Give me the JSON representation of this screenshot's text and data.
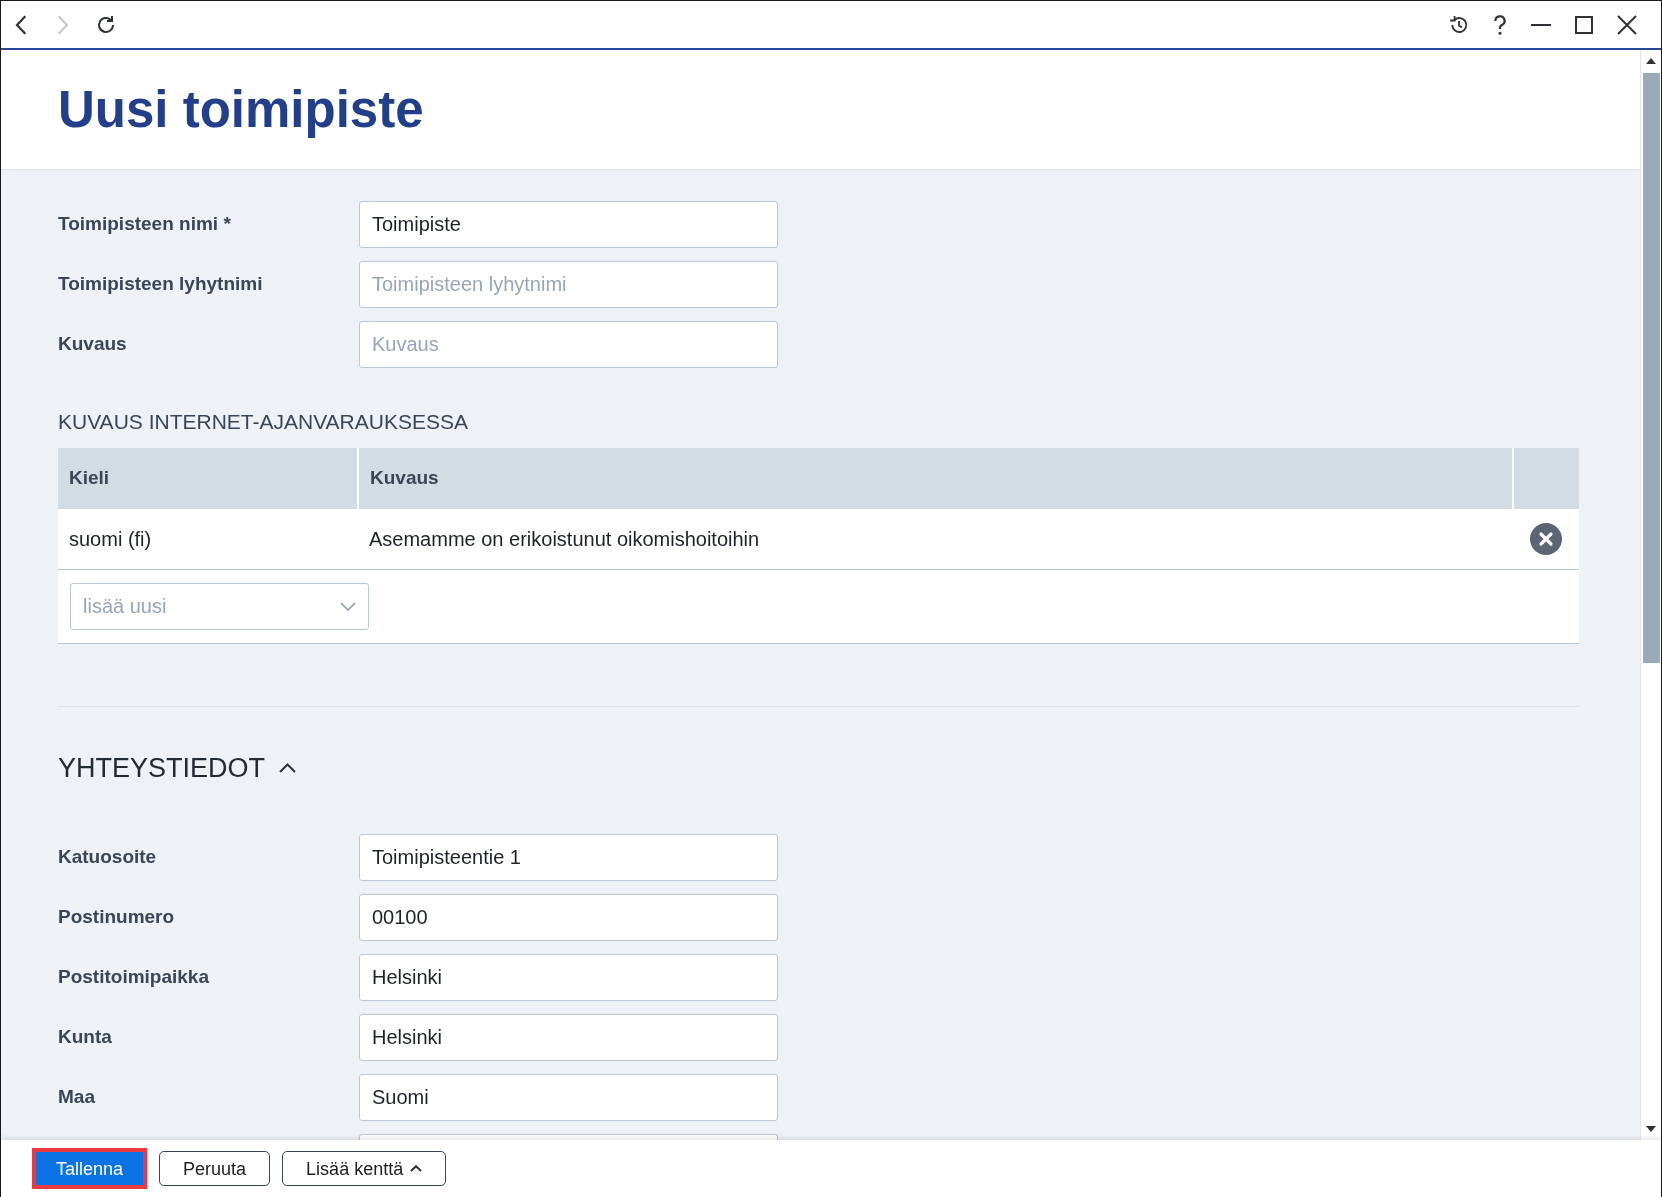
{
  "title_bar": {
    "navigation": [
      {
        "kind": "back",
        "disabled": false
      },
      {
        "kind": "forward",
        "disabled": true
      },
      {
        "kind": "reload",
        "disabled": false
      }
    ],
    "window_controls": [
      {
        "kind": "history"
      },
      {
        "kind": "help"
      },
      {
        "kind": "minimize"
      },
      {
        "kind": "maximize"
      },
      {
        "kind": "close"
      }
    ]
  },
  "page_title": "Uusi toimipiste",
  "basic_fields": [
    {
      "label": "Toimipisteen nimi *",
      "value": "Toimipiste"
    },
    {
      "label": "Toimipisteen lyhytnimi",
      "placeholder": "Toimipisteen lyhytnimi"
    },
    {
      "label": "Kuvaus",
      "placeholder": "Kuvaus"
    }
  ],
  "online_booking_description": {
    "heading": "KUVAUS INTERNET-AJANVARAUKSESSA",
    "table": {
      "columns": [
        "Kieli",
        "Kuvaus"
      ],
      "rows": [
        {
          "cells": [
            "suomi (fi)",
            "Asemamme on erikoistunut oikomishoitoihin"
          ],
          "removable": true
        }
      ]
    },
    "add_language": {
      "placeholder": "lisää uusi"
    }
  },
  "contact_section": {
    "heading": "YHTEYSTIEDOT",
    "expanded": true,
    "fields": [
      {
        "label": "Katuosoite",
        "value": "Toimipisteentie 1"
      },
      {
        "label": "Postinumero",
        "value": "00100"
      },
      {
        "label": "Postitoimipaikka",
        "value": "Helsinki"
      },
      {
        "label": "Kunta",
        "value": "Helsinki"
      },
      {
        "label": "Maa",
        "value": "Suomi"
      }
    ],
    "more_below": true
  },
  "footer": {
    "buttons": [
      {
        "label": "Tallenna",
        "kind": "primary",
        "highlighted": true,
        "caret": false
      },
      {
        "label": "Peruuta",
        "kind": "outline",
        "highlighted": false,
        "caret": false
      },
      {
        "label": "Lisää kenttä",
        "kind": "outline",
        "highlighted": false,
        "caret": true
      }
    ]
  }
}
